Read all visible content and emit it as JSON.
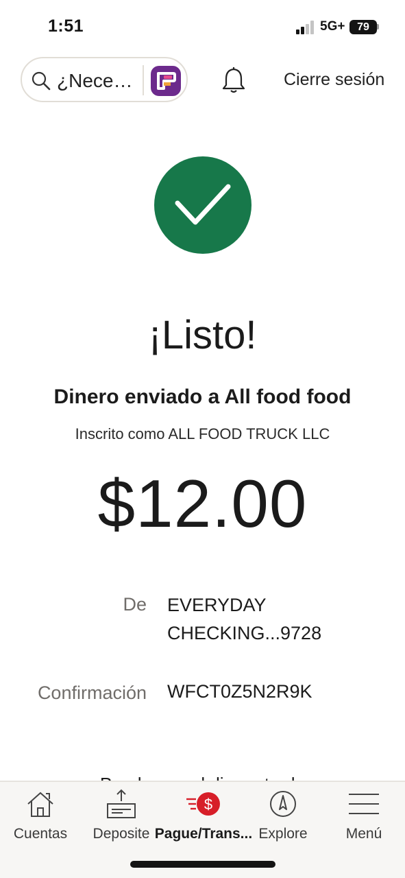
{
  "status_bar": {
    "time": "1:51",
    "network": "5G+",
    "battery": "79"
  },
  "header": {
    "search_placeholder": "¿Nece…",
    "signout_label": "Cierre sesión",
    "assistant_icon": "fargo-assistant-icon",
    "bell_icon": "bell-icon"
  },
  "confirmation": {
    "title": "¡Listo!",
    "sent_to": "Dinero enviado a All food food",
    "enrolled_as": "Inscrito como ALL FOOD TRUCK LLC",
    "amount": "$12.00",
    "from_label": "De",
    "from_value": "EVERYDAY CHECKING...9728",
    "confirmation_label": "Confirmación",
    "confirmation_value": "WFCT0Z5N2R9K",
    "next_text_partial": "Puede que el dinero tarde"
  },
  "nav": {
    "items": [
      {
        "label": "Cuentas",
        "icon": "home-icon",
        "active": false
      },
      {
        "label": "Deposite",
        "icon": "deposit-icon",
        "active": false
      },
      {
        "label": "Pague/Trans...",
        "icon": "pay-transfer-icon",
        "active": true
      },
      {
        "label": "Explore",
        "icon": "compass-icon",
        "active": false
      },
      {
        "label": "Menú",
        "icon": "menu-icon",
        "active": false
      }
    ]
  },
  "colors": {
    "success": "#17784a",
    "brand_red": "#d71e28",
    "fargo_purple": "#6c2a8c"
  }
}
